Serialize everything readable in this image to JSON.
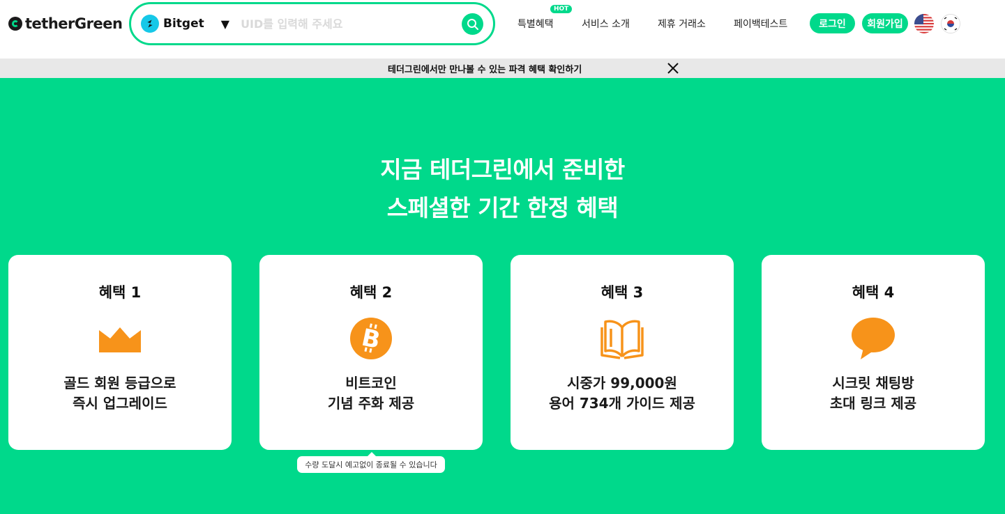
{
  "header": {
    "logo": "tetherGreen",
    "exchange": {
      "name": "Bitget",
      "icon": "bitget-icon"
    },
    "uid_placeholder": "UID를 입력해 주세요",
    "nav": [
      {
        "label": "특별혜택",
        "badge": "HOT"
      },
      {
        "label": "서비스 소개"
      },
      {
        "label": "제휴 거래소"
      },
      {
        "label": "페이백테스트"
      }
    ],
    "login": "로그인",
    "signup": "회원가입",
    "languages": [
      "en-us-flag-icon",
      "ko-kr-flag-icon"
    ]
  },
  "banner": {
    "text": "테더그린에서만 만나볼 수 있는 파격 혜택 확인하기"
  },
  "colors": {
    "accent": "#00d98b",
    "icon_orange": "#f7931a"
  },
  "main": {
    "headline": [
      "지금 테더그린에서 준비한",
      "스페셜한 기간 한정 혜택"
    ],
    "cards": [
      {
        "title": "혜택 1",
        "icon": "crown-icon",
        "desc": [
          "골드 회원 등급으로",
          "즉시 업그레이드"
        ]
      },
      {
        "title": "혜택 2",
        "icon": "bitcoin-icon",
        "desc": [
          "비트코인",
          "기념 주화 제공"
        ]
      },
      {
        "title": "혜택 3",
        "icon": "book-icon",
        "desc": [
          "시중가 99,000원",
          "용어 734개 가이드 제공"
        ]
      },
      {
        "title": "혜택 4",
        "icon": "chat-bubble-icon",
        "desc": [
          "시크릿 채팅방",
          "초대 링크 제공"
        ]
      }
    ],
    "tooltip": "수량 도달시 예고없이 종료될 수 있습니다"
  }
}
